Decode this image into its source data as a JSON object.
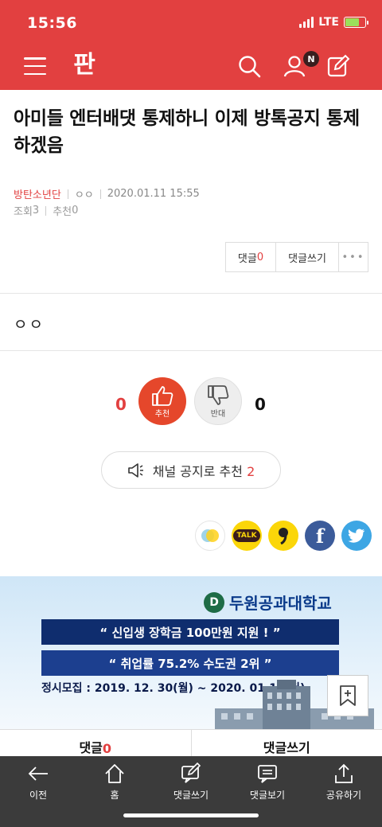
{
  "status": {
    "time": "15:56",
    "network": "LTE"
  },
  "header": {
    "logo_text": "판",
    "notification_badge": "N"
  },
  "article": {
    "title": "아미들 엔터배댓 통제하니 이제 방톡공지 통제하겠음",
    "channel": "방탄소년단",
    "author": "ㅇㅇ",
    "datetime": "2020.01.11 15:55",
    "views_label": "조회",
    "views": "3",
    "recommend_label": "추천",
    "recommend": "0",
    "body": "ㅇㅇ"
  },
  "actions": {
    "comment_label": "댓글",
    "comment_count": "0",
    "write_label": "댓글쓰기",
    "more_label": "•••"
  },
  "votes": {
    "up_count": "0",
    "up_label": "추천",
    "down_label": "반대",
    "down_count": "0"
  },
  "notice": {
    "label": "채널 공지로 추천",
    "count": "2"
  },
  "share": {
    "kakaotalk_label": "TALK",
    "facebook_label": "f"
  },
  "ad": {
    "logo_mark": "D",
    "school": "두원공과대학교",
    "line1": "“ 신입생 장학금 100만원 지원 ! ”",
    "line2": "“ 취업률 75.2% 수도권 2위 ”",
    "date": "정시모집 : 2019. 12. 30(월) ~ 2020. 01.13(월)"
  },
  "tabs": {
    "comment_label": "댓글",
    "comment_count": "0",
    "write_label": "댓글쓰기"
  },
  "bottom_nav": [
    {
      "label": "이전"
    },
    {
      "label": "홈"
    },
    {
      "label": "댓글쓰기"
    },
    {
      "label": "댓글보기"
    },
    {
      "label": "공유하기"
    }
  ],
  "colors": {
    "brand": "#e24040",
    "nav_bg": "#3b3b3b"
  }
}
